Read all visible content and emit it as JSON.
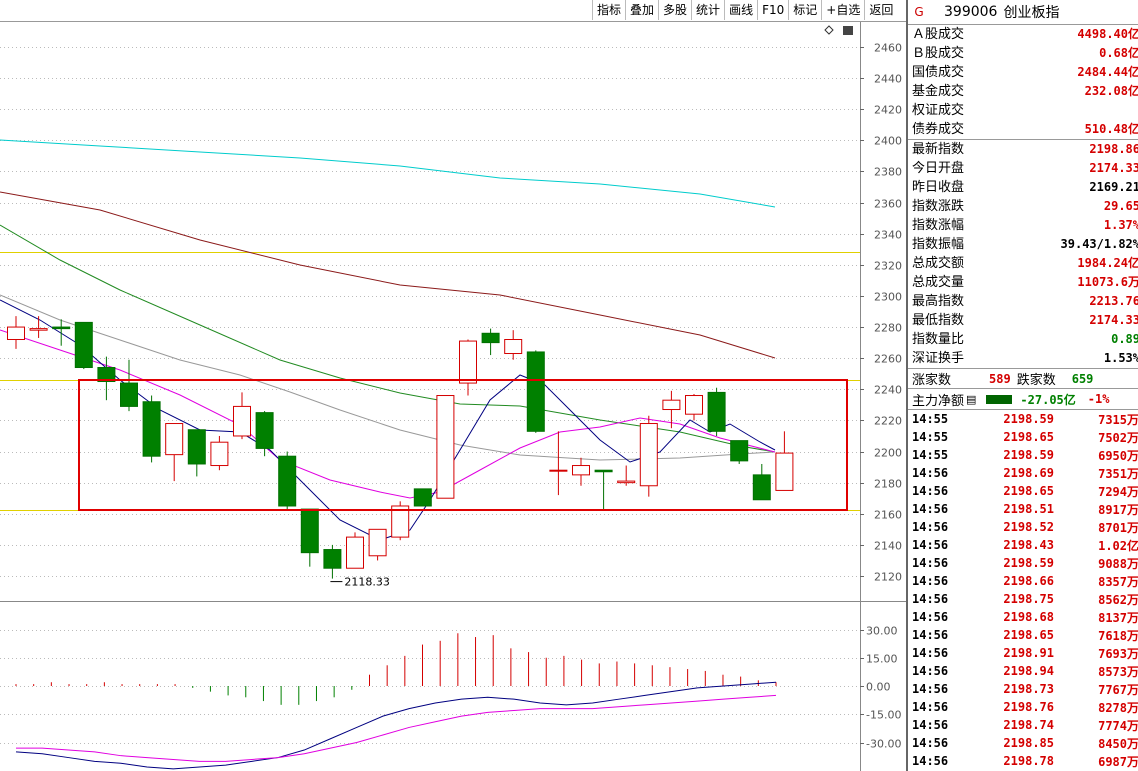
{
  "toolbar": {
    "items": [
      "指标",
      "叠加",
      "多股",
      "统计",
      "画线",
      "F10",
      "标记",
      "+自选",
      "返回"
    ]
  },
  "chart_data": [
    {
      "type": "candlestick",
      "y_ticks": [
        2460,
        2440,
        2420,
        2400,
        2380,
        2360,
        2340,
        2320,
        2300,
        2280,
        2260,
        2240,
        2220,
        2200,
        2180,
        2160,
        2140,
        2120
      ],
      "ylim": [
        2110,
        2468
      ],
      "low_annotation": "2118.33",
      "candles": [
        {
          "o": 2272,
          "h": 2287,
          "l": 2266,
          "c": 2280
        },
        {
          "o": 2278,
          "h": 2287,
          "l": 2273,
          "c": 2279
        },
        {
          "o": 2280,
          "h": 2285,
          "l": 2268,
          "c": 2279
        },
        {
          "o": 2283,
          "h": 2283,
          "l": 2253,
          "c": 2254
        },
        {
          "o": 2254,
          "h": 2261,
          "l": 2233,
          "c": 2245
        },
        {
          "o": 2244,
          "h": 2259,
          "l": 2226,
          "c": 2229
        },
        {
          "o": 2232,
          "h": 2236,
          "l": 2193,
          "c": 2197
        },
        {
          "o": 2198,
          "h": 2218,
          "l": 2181,
          "c": 2218
        },
        {
          "o": 2214,
          "h": 2214,
          "l": 2184,
          "c": 2192
        },
        {
          "o": 2191,
          "h": 2210,
          "l": 2188,
          "c": 2206
        },
        {
          "o": 2210,
          "h": 2238,
          "l": 2208,
          "c": 2229
        },
        {
          "o": 2225,
          "h": 2226,
          "l": 2197,
          "c": 2202
        },
        {
          "o": 2197,
          "h": 2200,
          "l": 2163,
          "c": 2165
        },
        {
          "o": 2163,
          "h": 2163,
          "l": 2126,
          "c": 2135
        },
        {
          "o": 2137,
          "h": 2140,
          "l": 2118.33,
          "c": 2125
        },
        {
          "o": 2125,
          "h": 2148,
          "l": 2125,
          "c": 2145
        },
        {
          "o": 2133,
          "h": 2150,
          "l": 2130,
          "c": 2150
        },
        {
          "o": 2145,
          "h": 2168,
          "l": 2143,
          "c": 2165
        },
        {
          "o": 2176,
          "h": 2176,
          "l": 2165,
          "c": 2165
        },
        {
          "o": 2170,
          "h": 2236,
          "l": 2170,
          "c": 2236
        },
        {
          "o": 2244,
          "h": 2272,
          "l": 2236,
          "c": 2271
        },
        {
          "o": 2276,
          "h": 2279,
          "l": 2262,
          "c": 2270
        },
        {
          "o": 2263,
          "h": 2278,
          "l": 2259,
          "c": 2272
        },
        {
          "o": 2264,
          "h": 2265,
          "l": 2212,
          "c": 2213
        },
        {
          "o": 2188,
          "h": 2213,
          "l": 2172,
          "c": 2188
        },
        {
          "o": 2185,
          "h": 2196,
          "l": 2178,
          "c": 2191
        },
        {
          "o": 2188,
          "h": 2188,
          "l": 2162,
          "c": 2187
        },
        {
          "o": 2180,
          "h": 2191,
          "l": 2178,
          "c": 2181
        },
        {
          "o": 2178,
          "h": 2223,
          "l": 2171,
          "c": 2218
        },
        {
          "o": 2227,
          "h": 2239,
          "l": 2215,
          "c": 2233
        },
        {
          "o": 2224,
          "h": 2237,
          "l": 2220,
          "c": 2236
        },
        {
          "o": 2238,
          "h": 2241,
          "l": 2210,
          "c": 2213
        },
        {
          "o": 2207,
          "h": 2207,
          "l": 2192,
          "c": 2194
        },
        {
          "o": 2185,
          "h": 2192,
          "l": 2169,
          "c": 2169
        },
        {
          "o": 2175,
          "h": 2213,
          "l": 2175,
          "c": 2199
        }
      ]
    },
    {
      "type": "bar",
      "y_ticks": [
        "30.00",
        "15.00",
        "0.00",
        "-15.00",
        "-30.00"
      ],
      "ylim": [
        -44,
        37
      ],
      "bars": [
        1,
        1,
        2,
        1,
        1,
        2,
        1,
        1,
        1,
        1,
        -1,
        -3,
        -5,
        -6,
        -8,
        -10,
        -10,
        -8,
        -6,
        -2,
        6,
        11,
        16,
        22,
        24,
        28,
        26,
        27,
        20,
        18,
        15,
        16,
        14,
        12,
        13,
        12,
        11,
        10,
        9,
        8,
        6,
        5,
        3,
        2
      ],
      "line1": [
        -35,
        -36,
        -38,
        -40,
        -41,
        -43,
        -44,
        -43,
        -42,
        -40,
        -38,
        -34,
        -28,
        -22,
        -16,
        -12,
        -9,
        -7,
        -6,
        -7,
        -9,
        -10,
        -9,
        -7,
        -5,
        -3,
        -1,
        0,
        1,
        2
      ],
      "line2": [
        -33,
        -33,
        -34,
        -35,
        -37,
        -38,
        -39,
        -40,
        -40,
        -39,
        -38,
        -36,
        -33,
        -30,
        -26,
        -22,
        -19,
        -16,
        -14,
        -13,
        -12,
        -12,
        -12,
        -11,
        -10,
        -9,
        -8,
        -7,
        -6,
        -5
      ]
    }
  ],
  "panel": {
    "g": "G",
    "code": "399006",
    "name": "创业板指",
    "rows1": [
      {
        "label": "Ａ股成交",
        "value": "4498.40亿",
        "cls": "red"
      },
      {
        "label": "Ｂ股成交",
        "value": "0.68亿",
        "cls": "red"
      },
      {
        "label": "国债成交",
        "value": "2484.44亿",
        "cls": "red"
      },
      {
        "label": "基金成交",
        "value": "232.08亿",
        "cls": "red"
      },
      {
        "label": "权证成交",
        "value": "",
        "cls": "red"
      },
      {
        "label": "债券成交",
        "value": "510.48亿",
        "cls": "red"
      }
    ],
    "rows2": [
      {
        "label": "最新指数",
        "value": "2198.86",
        "cls": "red"
      },
      {
        "label": "今日开盘",
        "value": "2174.33",
        "cls": "red"
      },
      {
        "label": "昨日收盘",
        "value": "2169.21",
        "cls": "blk"
      },
      {
        "label": "指数涨跌",
        "value": "29.65",
        "cls": "red"
      },
      {
        "label": "指数涨幅",
        "value": "1.37%",
        "cls": "red"
      },
      {
        "label": "指数振幅",
        "value": "39.43/1.82%",
        "cls": "blk"
      },
      {
        "label": "总成交额",
        "value": "1984.24亿",
        "cls": "red"
      },
      {
        "label": "总成交量",
        "value": "11073.6万",
        "cls": "red"
      },
      {
        "label": "最高指数",
        "value": "2213.76",
        "cls": "red"
      },
      {
        "label": "最低指数",
        "value": "2174.33",
        "cls": "red"
      },
      {
        "label": "指数量比",
        "value": "0.89",
        "cls": "grn"
      },
      {
        "label": "深证换手",
        "value": "1.53%",
        "cls": "blk"
      }
    ],
    "zhangjia_label": "涨家数",
    "zhangjia": "589",
    "diejia_label": "跌家数",
    "diejia": "659",
    "zhuli_label": "主力净额",
    "zhuli_value": "-27.05亿",
    "zhuli_pct": "-1%",
    "ticks": [
      {
        "t": "14:55",
        "p": "2198.59",
        "v": "7315万"
      },
      {
        "t": "14:55",
        "p": "2198.65",
        "v": "7502万"
      },
      {
        "t": "14:55",
        "p": "2198.59",
        "v": "6950万"
      },
      {
        "t": "14:56",
        "p": "2198.69",
        "v": "7351万"
      },
      {
        "t": "14:56",
        "p": "2198.65",
        "v": "7294万"
      },
      {
        "t": "14:56",
        "p": "2198.51",
        "v": "8917万"
      },
      {
        "t": "14:56",
        "p": "2198.52",
        "v": "8701万"
      },
      {
        "t": "14:56",
        "p": "2198.43",
        "v": "1.02亿"
      },
      {
        "t": "14:56",
        "p": "2198.59",
        "v": "9088万"
      },
      {
        "t": "14:56",
        "p": "2198.66",
        "v": "8357万"
      },
      {
        "t": "14:56",
        "p": "2198.75",
        "v": "8562万"
      },
      {
        "t": "14:56",
        "p": "2198.68",
        "v": "8137万"
      },
      {
        "t": "14:56",
        "p": "2198.65",
        "v": "7618万"
      },
      {
        "t": "14:56",
        "p": "2198.91",
        "v": "7693万"
      },
      {
        "t": "14:56",
        "p": "2198.94",
        "v": "8573万"
      },
      {
        "t": "14:56",
        "p": "2198.73",
        "v": "7767万"
      },
      {
        "t": "14:56",
        "p": "2198.76",
        "v": "8278万"
      },
      {
        "t": "14:56",
        "p": "2198.74",
        "v": "7774万"
      },
      {
        "t": "14:56",
        "p": "2198.85",
        "v": "8450万"
      },
      {
        "t": "14:56",
        "p": "2198.78",
        "v": "6987万"
      }
    ]
  }
}
